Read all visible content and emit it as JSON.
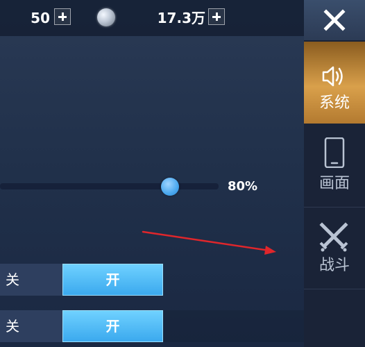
{
  "resources": {
    "first_value": "50",
    "second_value": "17.3万"
  },
  "sidebar": {
    "tabs": [
      {
        "label": "系统",
        "icon": "speaker-icon",
        "active": true
      },
      {
        "label": "画面",
        "icon": "phone-icon",
        "active": false
      },
      {
        "label": "战斗",
        "icon": "crossed-swords-icon",
        "active": false
      }
    ]
  },
  "volume": {
    "value_text": "80%",
    "level": 0.8
  },
  "toggles": [
    {
      "off_label": "关",
      "on_label": "开",
      "state": "on"
    },
    {
      "off_label": "关",
      "on_label": "开",
      "state": "on"
    }
  ],
  "colors": {
    "active_tab": "#d9a04b",
    "toggle_on": "#4ab4f0",
    "slider_knob": "#4aa8ef",
    "annotation_arrow": "#e0262b"
  }
}
